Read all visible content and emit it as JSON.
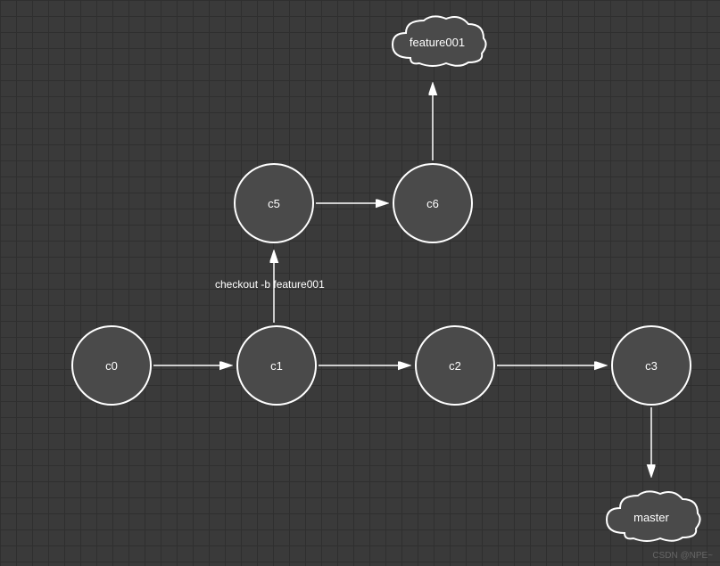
{
  "nodes": {
    "c0": "c0",
    "c1": "c1",
    "c2": "c2",
    "c3": "c3",
    "c5": "c5",
    "c6": "c6"
  },
  "branches": {
    "feature": "feature001",
    "master": "master"
  },
  "labels": {
    "checkout": "checkout -b feature001"
  },
  "watermarks": {
    "br": "CSDN @NPE~"
  },
  "chart_data": {
    "type": "diagram",
    "title": "Git branch diagram",
    "commits": [
      "c0",
      "c1",
      "c2",
      "c3",
      "c5",
      "c6"
    ],
    "edges": [
      {
        "from": "c0",
        "to": "c1"
      },
      {
        "from": "c1",
        "to": "c2"
      },
      {
        "from": "c2",
        "to": "c3"
      },
      {
        "from": "c1",
        "to": "c5",
        "label": "checkout -b feature001"
      },
      {
        "from": "c5",
        "to": "c6"
      }
    ],
    "branch_pointers": [
      {
        "branch": "feature001",
        "commit": "c6"
      },
      {
        "branch": "master",
        "commit": "c3"
      }
    ]
  }
}
